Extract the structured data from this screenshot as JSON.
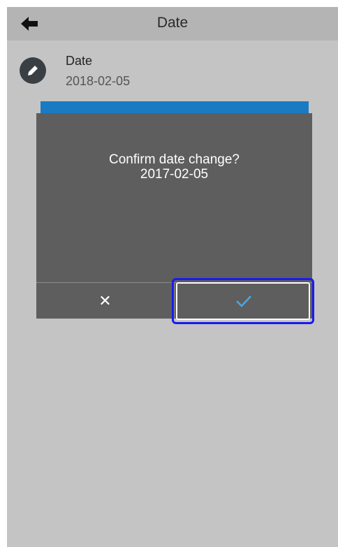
{
  "app_bar": {
    "title": "Date",
    "back_icon": "back-arrow-icon"
  },
  "setting": {
    "icon": "edit-pencil-icon",
    "label": "Date",
    "value": "2018-02-05"
  },
  "dialog": {
    "message_line1": "Confirm date change?",
    "message_line2": "2017-02-05",
    "cancel_glyph": "✕",
    "confirm_icon": "checkmark-icon"
  },
  "colors": {
    "app_bar": "#b4b4b4",
    "background": "#c4c4c4",
    "dialog": "#5e5e5e",
    "accent": "#1a7bc2",
    "checkmark": "#4aa8e6",
    "highlight": "#1a1af0"
  }
}
